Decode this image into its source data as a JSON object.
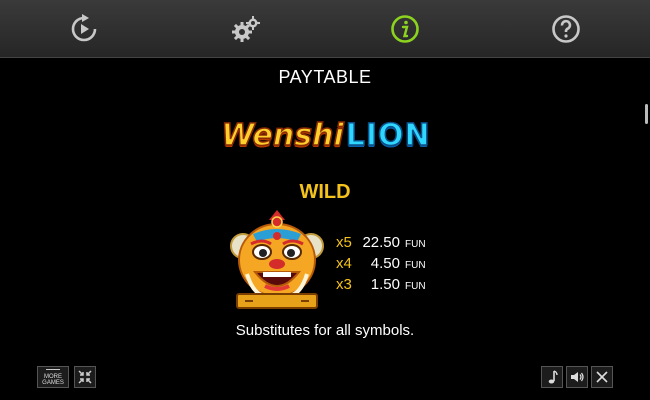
{
  "toolbar": {
    "buttons": [
      {
        "icon": "replay-icon"
      },
      {
        "icon": "settings-icon"
      },
      {
        "icon": "info-icon",
        "active": true
      },
      {
        "icon": "help-icon"
      }
    ],
    "active_color": "#8cd31f",
    "icon_color": "#c8c8c8"
  },
  "paytable": {
    "title": "PAYTABLE",
    "logo": {
      "part1": "Wenshi",
      "part2": "LION"
    },
    "symbol": {
      "name": "WILD",
      "image_icon": "lion-dance-head-icon",
      "payouts": [
        {
          "multiplier": "x5",
          "value": "22.50",
          "currency": "FUN"
        },
        {
          "multiplier": "x4",
          "value": "4.50",
          "currency": "FUN"
        },
        {
          "multiplier": "x3",
          "value": "1.50",
          "currency": "FUN"
        }
      ],
      "description": "Substitutes for all symbols."
    }
  },
  "bottom_bar": {
    "more_games_label_1": "MORE",
    "more_games_label_2": "GAMES",
    "buttons": [
      "more-games-icon",
      "fullscreen-icon",
      "music-icon",
      "sound-icon",
      "close-icon"
    ]
  },
  "colors": {
    "accent_gold": "#f3c21c",
    "background": "#000000"
  }
}
